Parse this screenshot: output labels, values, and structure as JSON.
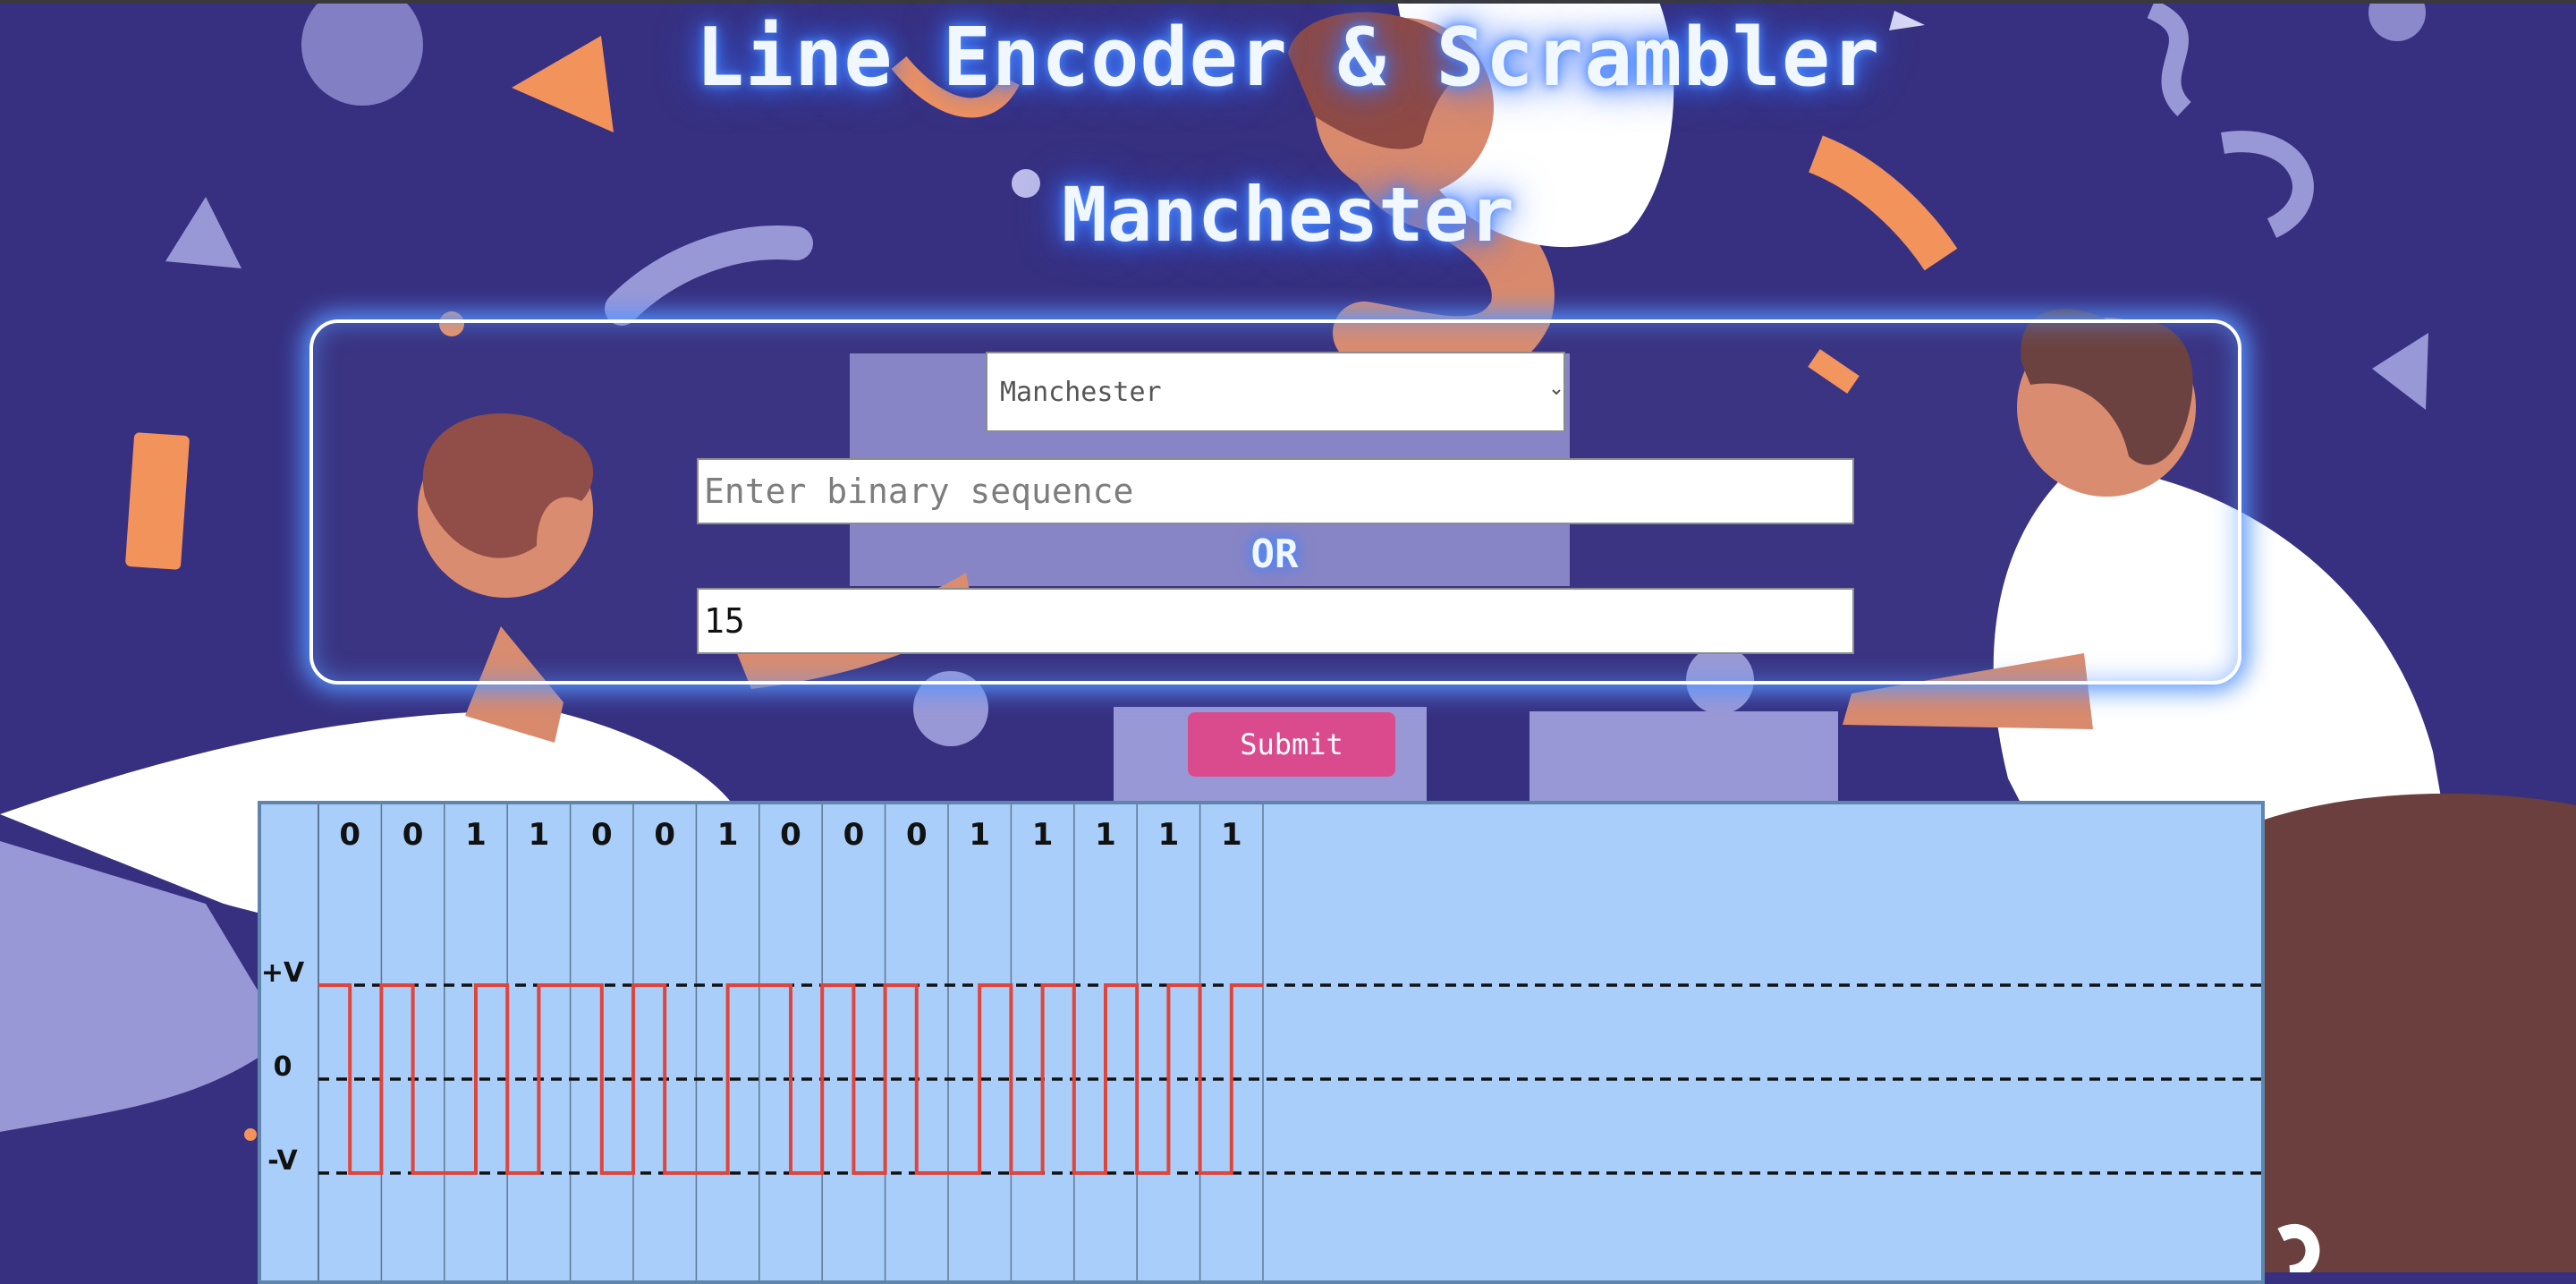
{
  "header": {
    "title": "Line Encoder & Scrambler",
    "subtitle": "Manchester"
  },
  "form": {
    "encoding_select": {
      "selected": "Manchester",
      "options": [
        "Manchester"
      ]
    },
    "binary_input": {
      "value": "",
      "placeholder": "Enter binary sequence"
    },
    "or_label": "OR",
    "decimal_input": {
      "value": "15",
      "placeholder": ""
    },
    "submit_label": "Submit"
  },
  "colors": {
    "page_background": "#373080",
    "panel_background": "#a9cef9",
    "panel_border": "#5f85ad",
    "signal": "#e0453c",
    "reference_line": "#111111",
    "submit_button": "#d94b8d",
    "glow": "#4f8bff"
  },
  "chart_data": {
    "type": "line",
    "encoding": "Manchester",
    "bits": [
      0,
      0,
      1,
      1,
      0,
      0,
      1,
      0,
      0,
      0,
      1,
      1,
      1,
      1,
      1
    ],
    "levels": [
      "+V",
      "0",
      "-V"
    ],
    "reference_levels": [
      1,
      0,
      -1
    ],
    "signal_series": {
      "name": "",
      "color": "#e0453c",
      "half_bit_levels": [
        1,
        -1,
        1,
        -1,
        -1,
        1,
        -1,
        1,
        1,
        -1,
        1,
        -1,
        -1,
        1,
        1,
        -1,
        1,
        -1,
        1,
        -1,
        -1,
        1,
        -1,
        1,
        -1,
        1,
        -1,
        1,
        -1,
        1
      ]
    },
    "grid": true,
    "bit_columns_total": 31
  }
}
